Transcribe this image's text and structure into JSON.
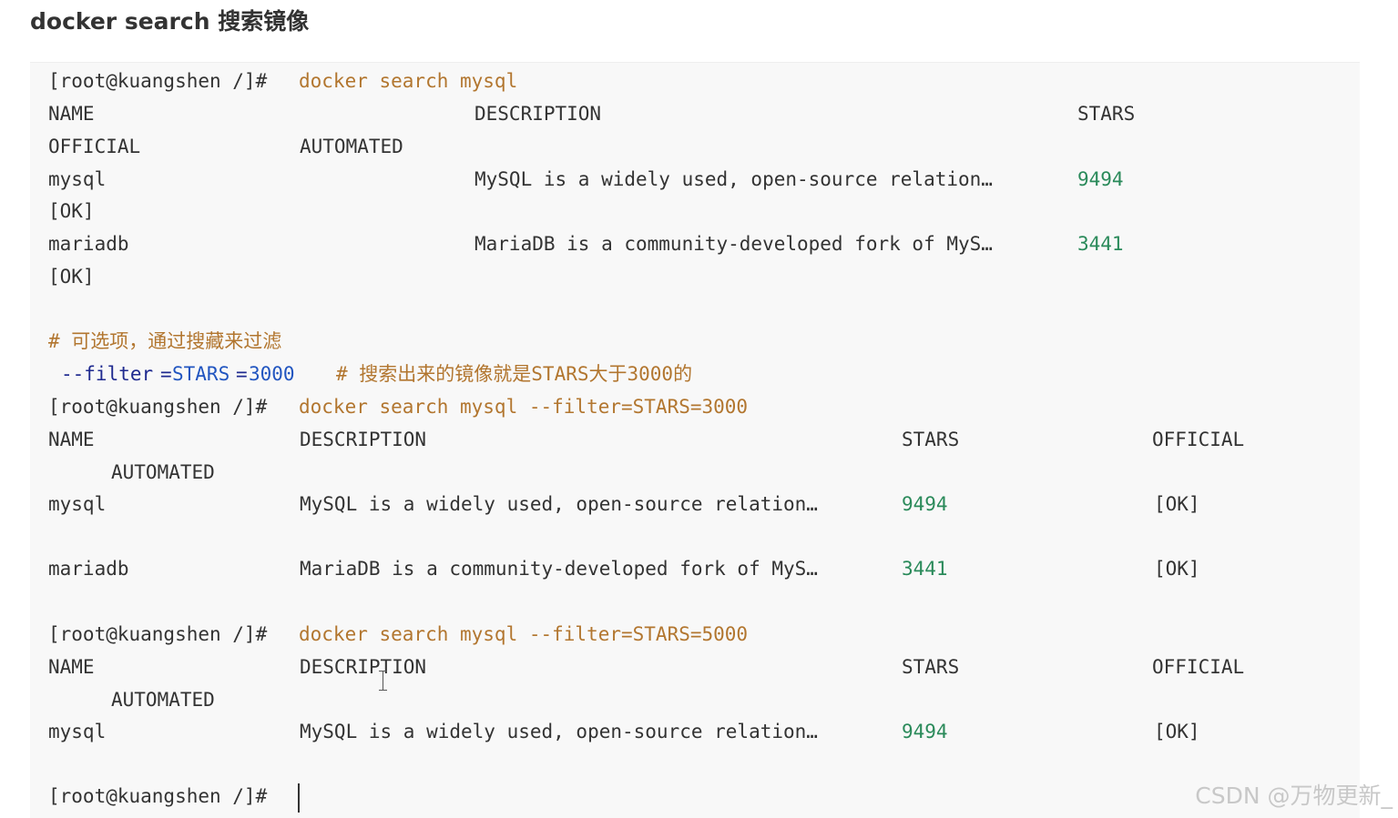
{
  "heading": "docker search 搜索镜像",
  "watermark": "CSDN @万物更新_",
  "session1": {
    "prompt": "[root@kuangshen /]# ",
    "command": "docker search mysql",
    "header": {
      "name": "NAME",
      "description": "DESCRIPTION",
      "stars": "STARS",
      "official": "OFFICIAL",
      "automated": "AUTOMATED"
    },
    "rows": [
      {
        "name": "mysql",
        "description": "MySQL is a widely used, open-source relation…",
        "stars": "9494",
        "official": "[OK]"
      },
      {
        "name": "mariadb",
        "description": "MariaDB is a community-developed fork of MyS…",
        "stars": "3441",
        "official": "[OK]"
      }
    ]
  },
  "comment_block": {
    "comment": "# 可选项，通过搜藏来过滤",
    "option_flag": "--filter",
    "option_eq1": "=",
    "option_key": "STARS",
    "option_eq2": "=",
    "option_value": "3000",
    "inline_comment": "# 搜索出来的镜像就是STARS大于3000的"
  },
  "session2": {
    "prompt": "[root@kuangshen /]# ",
    "command": "docker search mysql --filter=STARS=3000",
    "header": {
      "name": "NAME",
      "description": "DESCRIPTION",
      "stars": "STARS",
      "official": "OFFICIAL",
      "automated": "AUTOMATED"
    },
    "rows": [
      {
        "name": "mysql",
        "description": "MySQL is a widely used, open-source relation…",
        "stars": "9494",
        "official": "[OK]"
      },
      {
        "name": "mariadb",
        "description": "MariaDB is a community-developed fork of MyS…",
        "stars": "3441",
        "official": "[OK]"
      }
    ]
  },
  "session3": {
    "prompt": "[root@kuangshen /]# ",
    "command": "docker search mysql --filter=STARS=5000",
    "header": {
      "name": "NAME",
      "description": "DESCRIPTION",
      "stars": "STARS",
      "official": "OFFICIAL",
      "automated": "AUTOMATED"
    },
    "rows": [
      {
        "name": "mysql",
        "description": "MySQL is a widely used, open-source relation…",
        "stars": "9494",
        "official": "[OK]"
      }
    ]
  },
  "final_prompt": "[root@kuangshen /]# "
}
